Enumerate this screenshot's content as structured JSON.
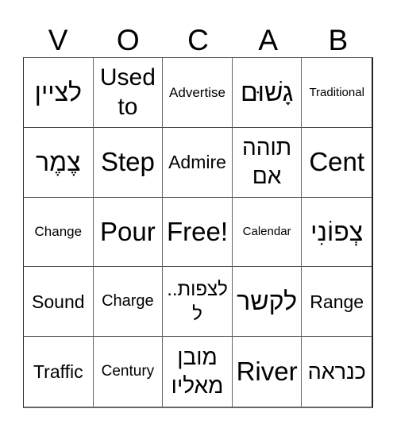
{
  "title_letters": [
    "V",
    "O",
    "C",
    "A",
    "B"
  ],
  "board": {
    "rows": [
      [
        "לציין",
        "Used to",
        "Advertise",
        "גָשׁוּם",
        "Traditional"
      ],
      [
        "צֶמֶר",
        "Step",
        "Admire",
        "תוהה אם",
        "Cent"
      ],
      [
        "Change",
        "Pour",
        "Free!",
        "Calendar",
        "צְפוֹנִי"
      ],
      [
        "Sound",
        "Charge",
        "לצפות..ל",
        "לקשר",
        "Range"
      ],
      [
        "Traffic",
        "Century",
        "מובן מאליו",
        "River",
        "כנראה"
      ]
    ],
    "free_space": "Free!"
  },
  "colors": {
    "background": "#ffffff",
    "text": "#000000",
    "grid_line": "#555555"
  }
}
